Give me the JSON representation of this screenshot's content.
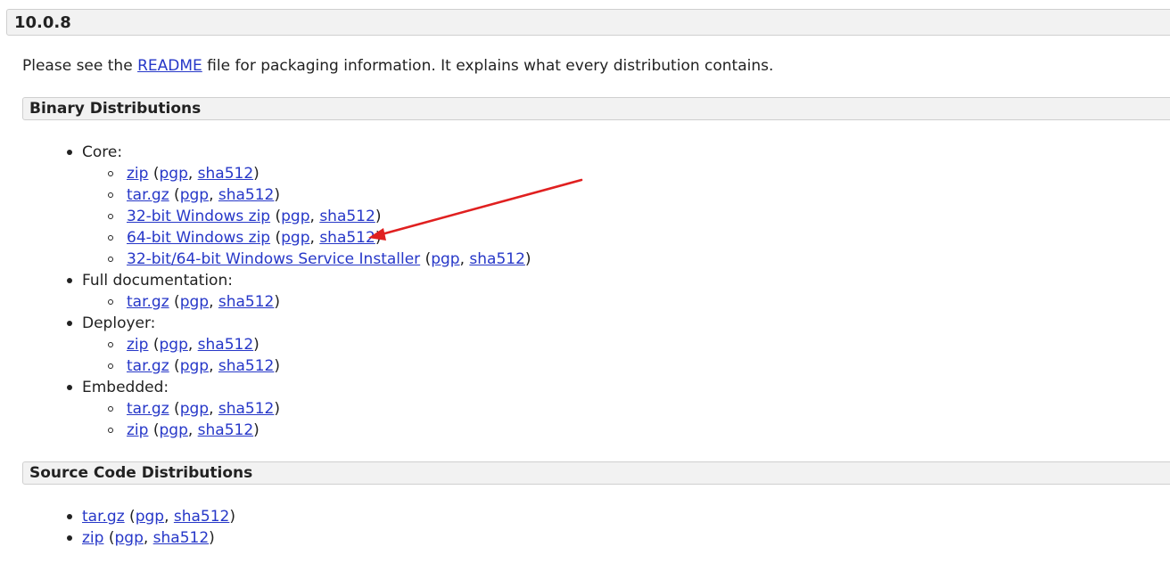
{
  "version": "10.0.8",
  "intro": {
    "before": "Please see the ",
    "link": "README",
    "after": " file for packaging information. It explains what every distribution contains."
  },
  "binary": {
    "title": "Binary Distributions",
    "groups": [
      {
        "label": "Core:",
        "items": [
          {
            "main": "zip",
            "pgp": "pgp",
            "sha": "sha512"
          },
          {
            "main": "tar.gz",
            "pgp": "pgp",
            "sha": "sha512"
          },
          {
            "main": "32-bit Windows zip",
            "pgp": "pgp",
            "sha": "sha512"
          },
          {
            "main": "64-bit Windows zip",
            "pgp": "pgp",
            "sha": "sha512"
          },
          {
            "main": "32-bit/64-bit Windows Service Installer",
            "pgp": "pgp",
            "sha": "sha512"
          }
        ]
      },
      {
        "label": "Full documentation:",
        "items": [
          {
            "main": "tar.gz",
            "pgp": "pgp",
            "sha": "sha512"
          }
        ]
      },
      {
        "label": "Deployer:",
        "items": [
          {
            "main": "zip",
            "pgp": "pgp",
            "sha": "sha512"
          },
          {
            "main": "tar.gz",
            "pgp": "pgp",
            "sha": "sha512"
          }
        ]
      },
      {
        "label": "Embedded:",
        "items": [
          {
            "main": "tar.gz",
            "pgp": "pgp",
            "sha": "sha512"
          },
          {
            "main": "zip",
            "pgp": "pgp",
            "sha": "sha512"
          }
        ]
      }
    ]
  },
  "source": {
    "title": "Source Code Distributions",
    "items": [
      {
        "main": "tar.gz",
        "pgp": "pgp",
        "sha": "sha512"
      },
      {
        "main": "zip",
        "pgp": "pgp",
        "sha": "sha512"
      }
    ]
  },
  "punct": {
    "open": " (",
    "comma": ", ",
    "close": ")"
  },
  "colors": {
    "link": "#2637c8",
    "annotation_arrow": "#e02020",
    "header_bg": "#f2f2f2"
  }
}
